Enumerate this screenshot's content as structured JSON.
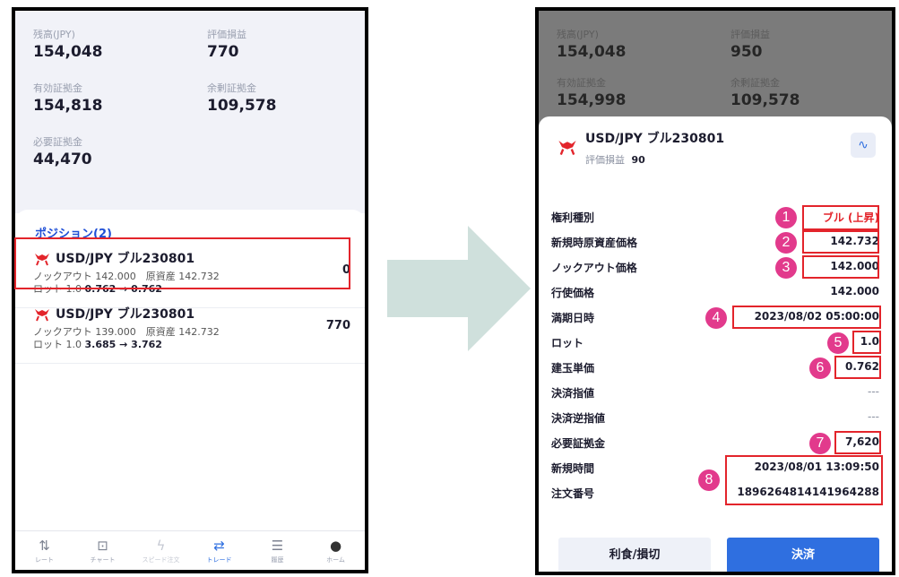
{
  "left": {
    "account": {
      "balance_label": "残高(JPY)",
      "balance": "154,048",
      "pl_label": "評価損益",
      "pl": "770",
      "equity_label": "有効証拠金",
      "equity": "154,818",
      "free_margin_label": "余剰証拠金",
      "free_margin": "109,578",
      "required_margin_label": "必要証拠金",
      "required_margin": "44,470"
    },
    "positions_title": "ポジション(2)",
    "positions": [
      {
        "name": "USD/JPY ブル230801",
        "pl": "0",
        "line1": "ノックアウト 142.000　原資産 142.732",
        "lot_prefix": "ロット 1.0",
        "price_change": "0.762 → 0.762"
      },
      {
        "name": "USD/JPY ブル230801",
        "pl": "770",
        "line1": "ノックアウト 139.000　原資産 142.732",
        "lot_prefix": "ロット 1.0",
        "price_change": "3.685 → 3.762"
      }
    ],
    "nav": [
      {
        "icon": "rate-icon",
        "label": "レート"
      },
      {
        "icon": "chart-icon",
        "label": "チャート"
      },
      {
        "icon": "speed-order-icon",
        "label": "スピード注文"
      },
      {
        "icon": "trade-icon",
        "label": "トレード"
      },
      {
        "icon": "history-icon",
        "label": "履歴"
      },
      {
        "icon": "home-icon",
        "label": "ホーム"
      }
    ]
  },
  "right": {
    "account": {
      "balance_label": "残高(JPY)",
      "balance": "154,048",
      "pl_label": "評価損益",
      "pl": "950",
      "equity_label": "有効証拠金",
      "equity": "154,998",
      "free_margin_label": "余剰証拠金",
      "free_margin": "109,578"
    },
    "detail": {
      "title": "USD/JPY ブル230801",
      "pl_label": "評価損益",
      "pl": "90",
      "rows": [
        {
          "label": "権利種別",
          "value": "ブル (上昇)"
        },
        {
          "label": "新規時原資産価格",
          "value": "142.732"
        },
        {
          "label": "ノックアウト価格",
          "value": "142.000"
        },
        {
          "label": "行使価格",
          "value": "142.000"
        },
        {
          "label": "満期日時",
          "value": "2023/08/02 05:00:00"
        },
        {
          "label": "ロット",
          "value": "1.0"
        },
        {
          "label": "建玉単価",
          "value": "0.762"
        },
        {
          "label": "決済指値",
          "value": "---"
        },
        {
          "label": "決済逆指値",
          "value": "---"
        },
        {
          "label": "必要証拠金",
          "value": "7,620"
        },
        {
          "label": "新規時間",
          "value": "2023/08/01 13:09:50"
        },
        {
          "label": "注文番号",
          "value": "1896264814141964288"
        }
      ],
      "badges": [
        "1",
        "2",
        "3",
        "4",
        "5",
        "6",
        "7",
        "8"
      ],
      "button_tp_sl": "利食/損切",
      "button_settle": "決済"
    }
  },
  "colors": {
    "accent": "#2f6fe0",
    "highlight": "#e3242b",
    "badge": "#e23a8c",
    "arrow": "#cfe0dc"
  }
}
